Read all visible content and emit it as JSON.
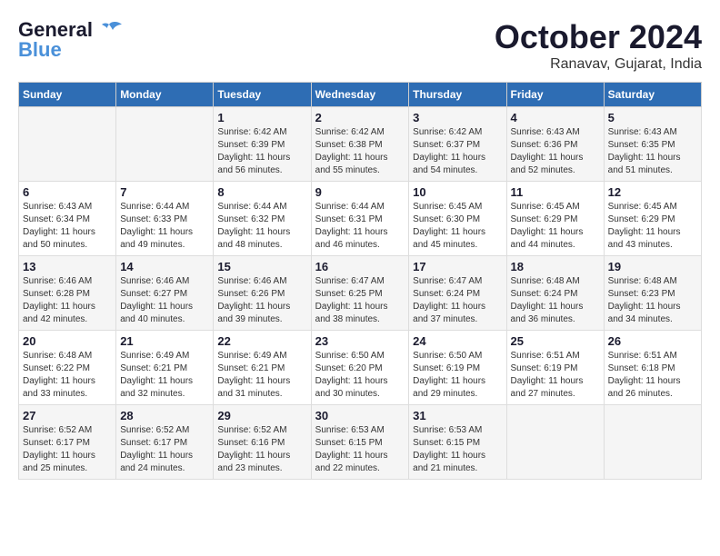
{
  "logo": {
    "general": "General",
    "blue": "Blue"
  },
  "header": {
    "month": "October 2024",
    "location": "Ranavav, Gujarat, India"
  },
  "weekdays": [
    "Sunday",
    "Monday",
    "Tuesday",
    "Wednesday",
    "Thursday",
    "Friday",
    "Saturday"
  ],
  "weeks": [
    [
      {
        "day": "",
        "sunrise": "",
        "sunset": "",
        "daylight": ""
      },
      {
        "day": "",
        "sunrise": "",
        "sunset": "",
        "daylight": ""
      },
      {
        "day": "1",
        "sunrise": "Sunrise: 6:42 AM",
        "sunset": "Sunset: 6:39 PM",
        "daylight": "Daylight: 11 hours and 56 minutes."
      },
      {
        "day": "2",
        "sunrise": "Sunrise: 6:42 AM",
        "sunset": "Sunset: 6:38 PM",
        "daylight": "Daylight: 11 hours and 55 minutes."
      },
      {
        "day": "3",
        "sunrise": "Sunrise: 6:42 AM",
        "sunset": "Sunset: 6:37 PM",
        "daylight": "Daylight: 11 hours and 54 minutes."
      },
      {
        "day": "4",
        "sunrise": "Sunrise: 6:43 AM",
        "sunset": "Sunset: 6:36 PM",
        "daylight": "Daylight: 11 hours and 52 minutes."
      },
      {
        "day": "5",
        "sunrise": "Sunrise: 6:43 AM",
        "sunset": "Sunset: 6:35 PM",
        "daylight": "Daylight: 11 hours and 51 minutes."
      }
    ],
    [
      {
        "day": "6",
        "sunrise": "Sunrise: 6:43 AM",
        "sunset": "Sunset: 6:34 PM",
        "daylight": "Daylight: 11 hours and 50 minutes."
      },
      {
        "day": "7",
        "sunrise": "Sunrise: 6:44 AM",
        "sunset": "Sunset: 6:33 PM",
        "daylight": "Daylight: 11 hours and 49 minutes."
      },
      {
        "day": "8",
        "sunrise": "Sunrise: 6:44 AM",
        "sunset": "Sunset: 6:32 PM",
        "daylight": "Daylight: 11 hours and 48 minutes."
      },
      {
        "day": "9",
        "sunrise": "Sunrise: 6:44 AM",
        "sunset": "Sunset: 6:31 PM",
        "daylight": "Daylight: 11 hours and 46 minutes."
      },
      {
        "day": "10",
        "sunrise": "Sunrise: 6:45 AM",
        "sunset": "Sunset: 6:30 PM",
        "daylight": "Daylight: 11 hours and 45 minutes."
      },
      {
        "day": "11",
        "sunrise": "Sunrise: 6:45 AM",
        "sunset": "Sunset: 6:29 PM",
        "daylight": "Daylight: 11 hours and 44 minutes."
      },
      {
        "day": "12",
        "sunrise": "Sunrise: 6:45 AM",
        "sunset": "Sunset: 6:29 PM",
        "daylight": "Daylight: 11 hours and 43 minutes."
      }
    ],
    [
      {
        "day": "13",
        "sunrise": "Sunrise: 6:46 AM",
        "sunset": "Sunset: 6:28 PM",
        "daylight": "Daylight: 11 hours and 42 minutes."
      },
      {
        "day": "14",
        "sunrise": "Sunrise: 6:46 AM",
        "sunset": "Sunset: 6:27 PM",
        "daylight": "Daylight: 11 hours and 40 minutes."
      },
      {
        "day": "15",
        "sunrise": "Sunrise: 6:46 AM",
        "sunset": "Sunset: 6:26 PM",
        "daylight": "Daylight: 11 hours and 39 minutes."
      },
      {
        "day": "16",
        "sunrise": "Sunrise: 6:47 AM",
        "sunset": "Sunset: 6:25 PM",
        "daylight": "Daylight: 11 hours and 38 minutes."
      },
      {
        "day": "17",
        "sunrise": "Sunrise: 6:47 AM",
        "sunset": "Sunset: 6:24 PM",
        "daylight": "Daylight: 11 hours and 37 minutes."
      },
      {
        "day": "18",
        "sunrise": "Sunrise: 6:48 AM",
        "sunset": "Sunset: 6:24 PM",
        "daylight": "Daylight: 11 hours and 36 minutes."
      },
      {
        "day": "19",
        "sunrise": "Sunrise: 6:48 AM",
        "sunset": "Sunset: 6:23 PM",
        "daylight": "Daylight: 11 hours and 34 minutes."
      }
    ],
    [
      {
        "day": "20",
        "sunrise": "Sunrise: 6:48 AM",
        "sunset": "Sunset: 6:22 PM",
        "daylight": "Daylight: 11 hours and 33 minutes."
      },
      {
        "day": "21",
        "sunrise": "Sunrise: 6:49 AM",
        "sunset": "Sunset: 6:21 PM",
        "daylight": "Daylight: 11 hours and 32 minutes."
      },
      {
        "day": "22",
        "sunrise": "Sunrise: 6:49 AM",
        "sunset": "Sunset: 6:21 PM",
        "daylight": "Daylight: 11 hours and 31 minutes."
      },
      {
        "day": "23",
        "sunrise": "Sunrise: 6:50 AM",
        "sunset": "Sunset: 6:20 PM",
        "daylight": "Daylight: 11 hours and 30 minutes."
      },
      {
        "day": "24",
        "sunrise": "Sunrise: 6:50 AM",
        "sunset": "Sunset: 6:19 PM",
        "daylight": "Daylight: 11 hours and 29 minutes."
      },
      {
        "day": "25",
        "sunrise": "Sunrise: 6:51 AM",
        "sunset": "Sunset: 6:19 PM",
        "daylight": "Daylight: 11 hours and 27 minutes."
      },
      {
        "day": "26",
        "sunrise": "Sunrise: 6:51 AM",
        "sunset": "Sunset: 6:18 PM",
        "daylight": "Daylight: 11 hours and 26 minutes."
      }
    ],
    [
      {
        "day": "27",
        "sunrise": "Sunrise: 6:52 AM",
        "sunset": "Sunset: 6:17 PM",
        "daylight": "Daylight: 11 hours and 25 minutes."
      },
      {
        "day": "28",
        "sunrise": "Sunrise: 6:52 AM",
        "sunset": "Sunset: 6:17 PM",
        "daylight": "Daylight: 11 hours and 24 minutes."
      },
      {
        "day": "29",
        "sunrise": "Sunrise: 6:52 AM",
        "sunset": "Sunset: 6:16 PM",
        "daylight": "Daylight: 11 hours and 23 minutes."
      },
      {
        "day": "30",
        "sunrise": "Sunrise: 6:53 AM",
        "sunset": "Sunset: 6:15 PM",
        "daylight": "Daylight: 11 hours and 22 minutes."
      },
      {
        "day": "31",
        "sunrise": "Sunrise: 6:53 AM",
        "sunset": "Sunset: 6:15 PM",
        "daylight": "Daylight: 11 hours and 21 minutes."
      },
      {
        "day": "",
        "sunrise": "",
        "sunset": "",
        "daylight": ""
      },
      {
        "day": "",
        "sunrise": "",
        "sunset": "",
        "daylight": ""
      }
    ]
  ]
}
